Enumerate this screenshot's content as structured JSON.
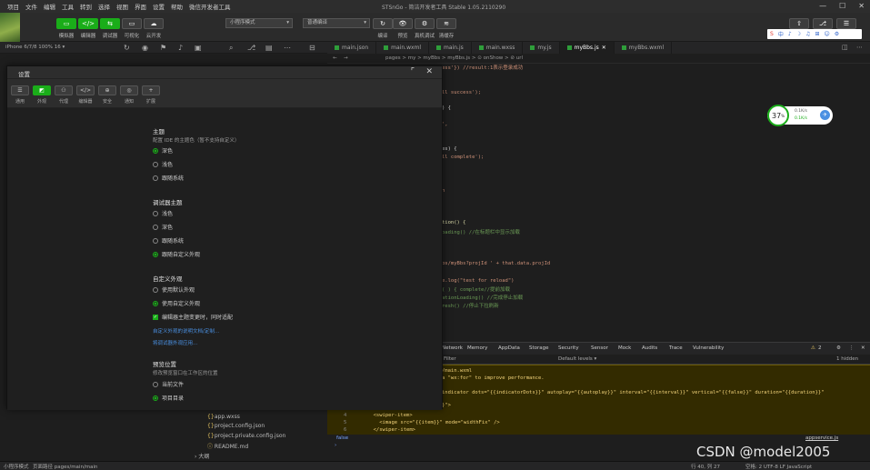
{
  "window": {
    "title": "STSnGo - 简洁开发者工具 Stable 1.05.2110290",
    "menu": [
      "项目",
      "文件",
      "编辑",
      "工具",
      "转到",
      "选择",
      "视图",
      "界面",
      "设置",
      "帮助",
      "微信开发者工具"
    ]
  },
  "toolbar": {
    "buttons": [
      {
        "icon": "phone-icon",
        "glyph": "▭",
        "label": "模拟器"
      },
      {
        "icon": "code-icon",
        "glyph": "</>",
        "label": "编辑器"
      },
      {
        "icon": "debug-icon",
        "glyph": "⇆",
        "label": "调试器"
      },
      {
        "icon": "visual-icon",
        "glyph": "▭",
        "label": "可视化"
      },
      {
        "icon": "cloud-icon",
        "glyph": "☁",
        "label": "云开发"
      }
    ],
    "mode_select": "小程序模式",
    "compile_select": "普通编译",
    "right_buttons": [
      {
        "icon": "compile-icon",
        "glyph": "↻",
        "label": "编译"
      },
      {
        "icon": "preview-icon",
        "glyph": "👁",
        "label": "预览"
      },
      {
        "icon": "real-debug-icon",
        "glyph": "⚙",
        "label": "真机调试"
      },
      {
        "icon": "clear-cache-icon",
        "glyph": "≋",
        "label": "清缓存"
      }
    ],
    "far_right": [
      {
        "icon": "upload-icon",
        "glyph": "⇧",
        "label": "上传"
      },
      {
        "icon": "version-icon",
        "glyph": "⎇",
        "label": "版本管理"
      },
      {
        "icon": "detail-icon",
        "glyph": "☰",
        "label": "详情"
      }
    ]
  },
  "device": {
    "label": "iPhone 6/7/8 100% 16 ▾"
  },
  "editor": {
    "tabs": [
      {
        "name": "main.json",
        "active": false
      },
      {
        "name": "main.wxml",
        "active": false
      },
      {
        "name": "main.js",
        "active": false
      },
      {
        "name": "main.wxss",
        "active": false
      },
      {
        "name": "my.js",
        "active": false
      },
      {
        "name": "myBbs.js",
        "active": true
      },
      {
        "name": "myBbs.wxml",
        "active": false
      }
    ],
    "breadcrumb": "pages > my > myBbs > myBbs.js > ⊙ onShow > ⊘ url",
    "lines": [
      {
        "text": "ess'}) //result:1表示登录成功",
        "kind": "str"
      },
      {
        "text": "ll success');",
        "kind": "str"
      },
      {
        "text": ") {",
        "kind": "pl"
      },
      {
        "text": "',",
        "kind": "str"
      },
      {
        "text": "es) {",
        "kind": "pl"
      },
      {
        "text": "ll complete');",
        "kind": "str"
      },
      {
        "text": "n",
        "kind": "str"
      },
      {
        "text": "tion() {",
        "kind": "fn"
      },
      {
        "text": "oading() //在标题栏中显示加载",
        "kind": "cm"
      },
      {
        "text": "bs/myBbs?projId ' + that.data.projId",
        "kind": "str"
      },
      {
        "text": "e.log(\"test for reload\")",
        "kind": "str"
      },
      {
        "text": "( ) { complete//提前加载",
        "kind": "cm"
      },
      {
        "text": "ationLoading() //完成停止加载",
        "kind": "cm"
      },
      {
        "text": "resh() //停止下拉刷新",
        "kind": "cm"
      }
    ]
  },
  "widget": {
    "percent": "37",
    "unit": "%",
    "up": "0.1K/s",
    "down": "0.1K/s"
  },
  "ime": [
    "中",
    "♪",
    "☽",
    "♫",
    "⊞",
    "☺",
    "⚙"
  ],
  "devtools": {
    "tabs": [
      "Network",
      "Memory",
      "AppData",
      "Storage",
      "Security",
      "Sensor",
      "Mock",
      "Audits",
      "Trace",
      "Vulnerability"
    ],
    "filter_label": "Filter",
    "level_select": "Default levels ▾",
    "hidden_count": "1 hidden",
    "warn_count": "2",
    "console_lines": [
      {
        "ln": "",
        "text": "/main.wxml"
      },
      {
        "ln": "",
        "text": "a \"wx:for\" to improve performance."
      },
      {
        "ln": "",
        "text": "indicator dots=\"{{indicatorDots}}\" autoplay=\"{{autoplay}}\" interval=\"{{interval}}\" vertical=\"{{false}}\" duration=\"{{duration}}\""
      },
      {
        "ln": "",
        "text": "}\">"
      },
      {
        "ln": "4",
        "text": "  <swiper-item>"
      },
      {
        "ln": "5",
        "text": "    <image src=\"{{item}}\" mode=\"widthFix\" />"
      },
      {
        "ln": "6",
        "text": "  </swiper-item>"
      }
    ],
    "source_link": "appservice.js",
    "false_label": "false"
  },
  "tree": [
    "app.wxss",
    "project.config.json",
    "project.private.config.json",
    "README.md"
  ],
  "status": {
    "left": "小程序模式",
    "path": "页面路径 pages/main/main",
    "outline": "大纲",
    "lncol": "行 40, 列 27",
    "encoding": "空格: 2  UTF-8  LF  JavaScript"
  },
  "modal": {
    "title": "设置",
    "tabs": [
      {
        "icon": "general-icon",
        "glyph": "☰",
        "label": "通用"
      },
      {
        "icon": "appearance-icon",
        "glyph": "◩",
        "label": "外观"
      },
      {
        "icon": "proxy-icon",
        "glyph": "⚇",
        "label": "代理"
      },
      {
        "icon": "editor-set-icon",
        "glyph": "</>",
        "label": "编辑器"
      },
      {
        "icon": "security-icon",
        "glyph": "⊕",
        "label": "安全"
      },
      {
        "icon": "notify-icon",
        "glyph": "◎",
        "label": "通知"
      },
      {
        "icon": "extensions-icon",
        "glyph": "+",
        "label": "扩展"
      }
    ],
    "active_tab": 1,
    "sections": [
      {
        "title": "主题",
        "desc": "配置 IDE 的主题色（暂不支持自定义）",
        "options": [
          {
            "label": "深色",
            "checked": true
          },
          {
            "label": "浅色",
            "checked": false
          },
          {
            "label": "跟随系统",
            "checked": false
          }
        ]
      },
      {
        "title": "调试器主题",
        "desc": "",
        "options": [
          {
            "label": "浅色",
            "checked": false
          },
          {
            "label": "深色",
            "checked": false
          },
          {
            "label": "跟随系统",
            "checked": false
          },
          {
            "label": "跟随自定义外观",
            "checked": true
          }
        ]
      },
      {
        "title": "自定义外观",
        "desc": "",
        "options": [
          {
            "label": "使用默认外观",
            "checked": false
          },
          {
            "label": "使用自定义外观",
            "checked": true
          }
        ],
        "checkbox": "编辑器主题变更时，同时适配",
        "links": [
          "自定义外观的说明文档/定制...",
          "将调试器外观应用..."
        ]
      },
      {
        "title": "预览位置",
        "desc": "修改预览窗口在工作区的位置",
        "options": [
          {
            "label": "当前文件",
            "checked": false
          },
          {
            "label": "项目目录",
            "checked": true
          }
        ]
      }
    ]
  },
  "watermark": "CSDN @model2005"
}
